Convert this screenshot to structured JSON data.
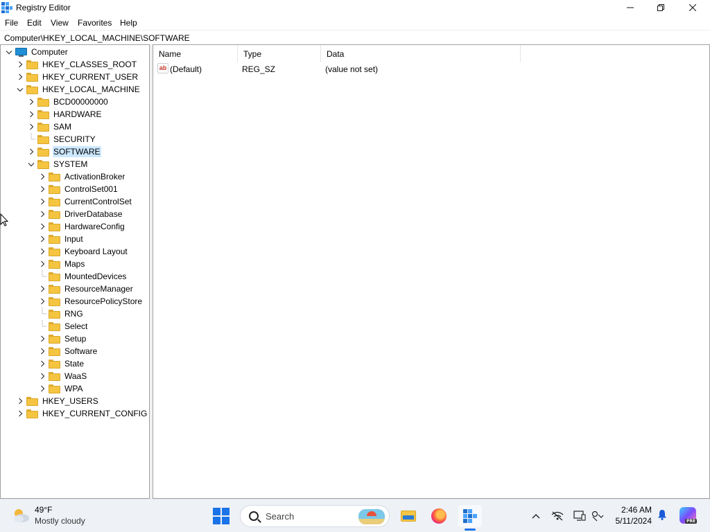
{
  "window": {
    "title": "Registry Editor",
    "app_icon": "regedit-icon",
    "controls": {
      "minimize": "minimize-icon",
      "maximize": "restore-icon",
      "close": "close-icon"
    }
  },
  "menu": {
    "items": [
      "File",
      "Edit",
      "View",
      "Favorites",
      "Help"
    ]
  },
  "address": {
    "path": "Computer\\HKEY_LOCAL_MACHINE\\SOFTWARE"
  },
  "tree": {
    "root": "Computer",
    "nodes": [
      {
        "label": "HKEY_CLASSES_ROOT",
        "depth": 1,
        "expander": "collapsed"
      },
      {
        "label": "HKEY_CURRENT_USER",
        "depth": 1,
        "expander": "collapsed"
      },
      {
        "label": "HKEY_LOCAL_MACHINE",
        "depth": 1,
        "expander": "expanded"
      },
      {
        "label": "BCD00000000",
        "depth": 2,
        "expander": "collapsed"
      },
      {
        "label": "HARDWARE",
        "depth": 2,
        "expander": "collapsed"
      },
      {
        "label": "SAM",
        "depth": 2,
        "expander": "collapsed"
      },
      {
        "label": "SECURITY",
        "depth": 2,
        "expander": "none"
      },
      {
        "label": "SOFTWARE",
        "depth": 2,
        "expander": "collapsed",
        "selected": true
      },
      {
        "label": "SYSTEM",
        "depth": 2,
        "expander": "expanded"
      },
      {
        "label": "ActivationBroker",
        "depth": 3,
        "expander": "collapsed"
      },
      {
        "label": "ControlSet001",
        "depth": 3,
        "expander": "collapsed"
      },
      {
        "label": "CurrentControlSet",
        "depth": 3,
        "expander": "collapsed"
      },
      {
        "label": "DriverDatabase",
        "depth": 3,
        "expander": "collapsed"
      },
      {
        "label": "HardwareConfig",
        "depth": 3,
        "expander": "collapsed"
      },
      {
        "label": "Input",
        "depth": 3,
        "expander": "collapsed"
      },
      {
        "label": "Keyboard Layout",
        "depth": 3,
        "expander": "collapsed"
      },
      {
        "label": "Maps",
        "depth": 3,
        "expander": "collapsed"
      },
      {
        "label": "MountedDevices",
        "depth": 3,
        "expander": "none"
      },
      {
        "label": "ResourceManager",
        "depth": 3,
        "expander": "collapsed"
      },
      {
        "label": "ResourcePolicyStore",
        "depth": 3,
        "expander": "collapsed"
      },
      {
        "label": "RNG",
        "depth": 3,
        "expander": "none"
      },
      {
        "label": "Select",
        "depth": 3,
        "expander": "none"
      },
      {
        "label": "Setup",
        "depth": 3,
        "expander": "collapsed"
      },
      {
        "label": "Software",
        "depth": 3,
        "expander": "collapsed"
      },
      {
        "label": "State",
        "depth": 3,
        "expander": "collapsed"
      },
      {
        "label": "WaaS",
        "depth": 3,
        "expander": "collapsed"
      },
      {
        "label": "WPA",
        "depth": 3,
        "expander": "collapsed"
      },
      {
        "label": "HKEY_USERS",
        "depth": 1,
        "expander": "collapsed"
      },
      {
        "label": "HKEY_CURRENT_CONFIG",
        "depth": 1,
        "expander": "collapsed"
      }
    ]
  },
  "values_list": {
    "columns": [
      "Name",
      "Type",
      "Data"
    ],
    "rows": [
      {
        "name": "(Default)",
        "type": "REG_SZ",
        "data": "(value not set)",
        "icon": "string-value-icon"
      }
    ]
  },
  "taskbar": {
    "weather": {
      "temp": "49°F",
      "condition": "Mostly cloudy",
      "icon": "partly-cloudy-icon"
    },
    "search_placeholder": "Search",
    "pinned_apps": [
      "file-explorer-icon",
      "firefox-icon",
      "regedit-icon"
    ],
    "active_app": "regedit-icon",
    "tray_icons": [
      "chevron-up-icon",
      "network-offline-icon",
      "display-icon",
      "accessibility-icon"
    ],
    "clock": {
      "time": "2:46 AM",
      "date": "5/11/2024"
    },
    "copilot_badge": "PRE"
  },
  "colors": {
    "selection": "#cce8ff",
    "folder": "#f5c542",
    "accent": "#1a73e8",
    "taskbar": "#eef1f6"
  }
}
